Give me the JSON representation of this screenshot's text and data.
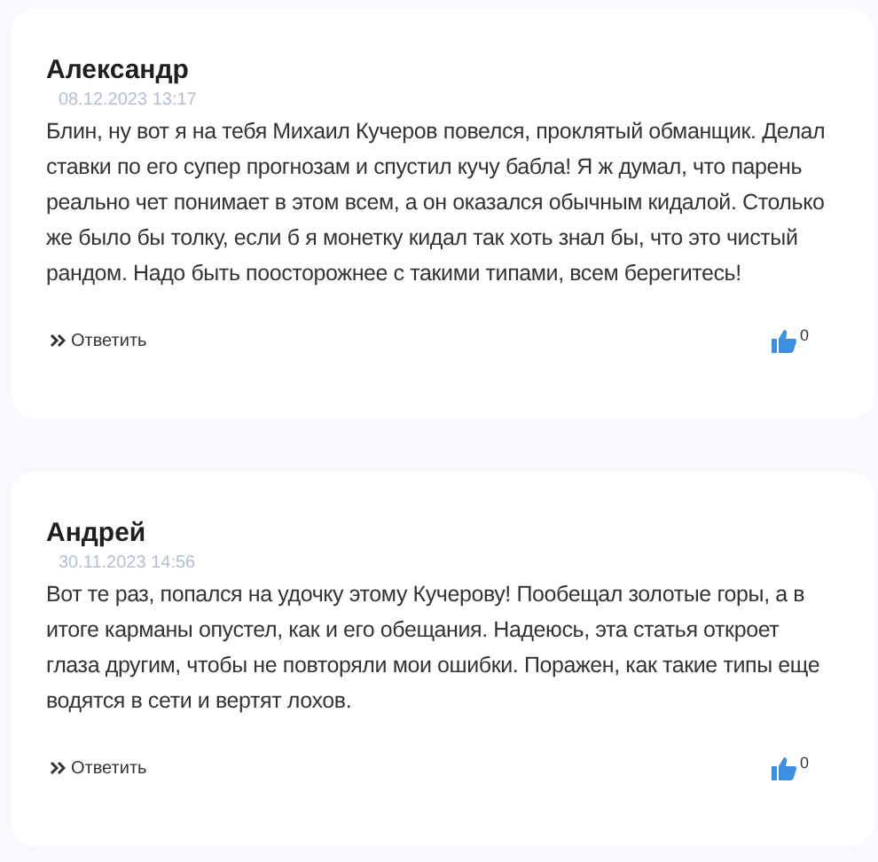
{
  "comments": [
    {
      "author": "Александр",
      "date": "08.12.2023 13:17",
      "text": "Блин, ну вот я на тебя Михаил Кучеров повелся, проклятый обманщик. Делал ставки по его супер прогнозам и спустил кучу бабла! Я ж думал, что парень реально чет понимает в этом всем, а он оказался обычным кидалой. Столько же было бы толку, если б я монетку кидал так хоть знал бы, что это чистый рандом. Надо быть поосторожнее с такими типами, всем берегитесь!",
      "reply": "Ответить",
      "likes": "0"
    },
    {
      "author": "Андрей",
      "date": "30.11.2023 14:56",
      "text": "Вот те раз, попался на удочку этому Кучерову! Пообещал золотые горы, а в итоге карманы опустел, как и его обещания. Надеюсь, эта статья откроет глаза другим, чтобы не повторяли мои ошибки. Поражен, как такие типы еще водятся в сети и вертят лохов.",
      "reply": "Ответить",
      "likes": "0"
    }
  ]
}
